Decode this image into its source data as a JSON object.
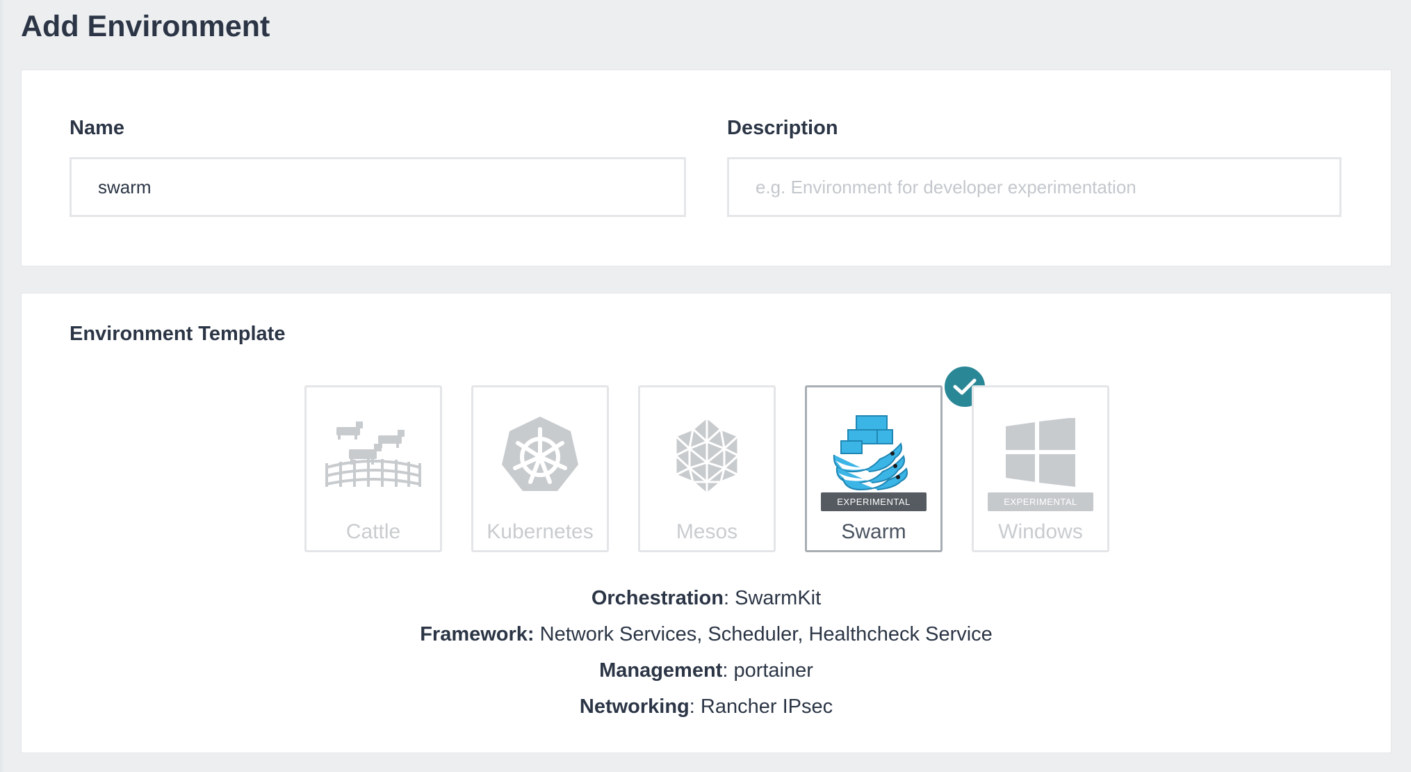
{
  "page": {
    "title": "Add Environment"
  },
  "form": {
    "name_label": "Name",
    "name_value": "swarm",
    "description_label": "Description",
    "description_placeholder": "e.g. Environment for developer experimentation"
  },
  "template_section": {
    "title": "Environment Template",
    "tiles": [
      {
        "label": "Cattle",
        "icon": "cattle-icon",
        "badge": "",
        "selected": false
      },
      {
        "label": "Kubernetes",
        "icon": "kubernetes-icon",
        "badge": "",
        "selected": false
      },
      {
        "label": "Mesos",
        "icon": "mesos-icon",
        "badge": "",
        "selected": false
      },
      {
        "label": "Swarm",
        "icon": "docker-swarm-icon",
        "badge": "EXPERIMENTAL",
        "selected": true
      },
      {
        "label": "Windows",
        "icon": "windows-icon",
        "badge": "EXPERIMENTAL",
        "selected": false
      }
    ]
  },
  "details": {
    "orchestration_label": "Orchestration",
    "orchestration_sep": ": ",
    "orchestration_value": "SwarmKit",
    "framework_label": "Framework:",
    "framework_value": " Network Services, Scheduler, Healthcheck Service",
    "management_label": "Management",
    "management_sep": ": ",
    "management_value": "portainer",
    "networking_label": "Networking",
    "networking_sep": ": ",
    "networking_value": "Rancher IPsec"
  },
  "colors": {
    "accent": "#2a8796",
    "page_background": "#eceef0",
    "text": "#2b3545",
    "disabled_text": "#c9cccf",
    "badge_selected": "#555b61",
    "badge_disabled": "#c6c9cc",
    "docker_blue": "#3bb4e6"
  }
}
